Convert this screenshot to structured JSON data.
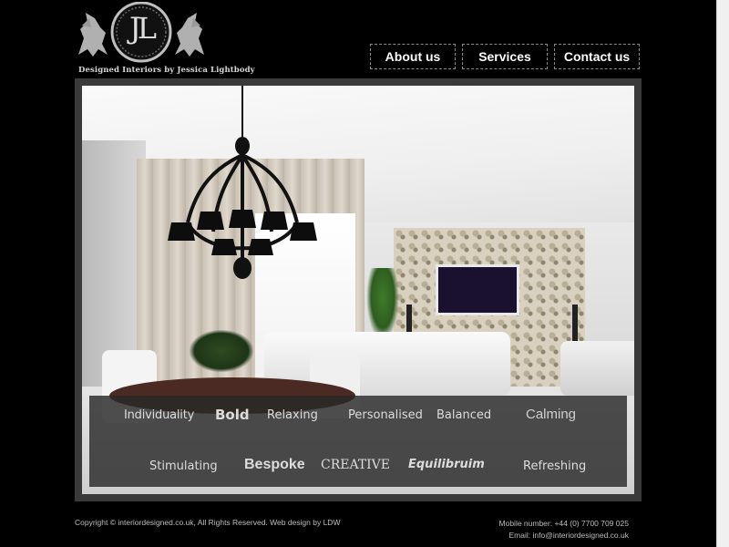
{
  "logo": {
    "monogram": "JL",
    "tagline": "Designed Interiors by Jessica Lightbody"
  },
  "nav": {
    "about_label": "About us",
    "services_label": "Services",
    "contact_label": "Contact us"
  },
  "hero": {
    "words": {
      "w1": "Individuality",
      "w2": "Bold",
      "w3": "Relaxing",
      "w4": "Personalised",
      "w5": "Balanced",
      "w6": "Calming",
      "w7": "Stimulating",
      "w8": "Bespoke",
      "w9": "CREATIVE",
      "w10": "Equilibruim",
      "w11": "Refreshing"
    }
  },
  "footer": {
    "copyright": "Copyright © interiordesigned.co.uk, All Rights Reserved. Web design by LDW",
    "mobile": "Mobile number: +44 (0) 7700 709 025",
    "email": "Email: info@interiordesigned.co.uk"
  },
  "colors": {
    "background": "#000000",
    "frame": "#3a3a3a",
    "nav_text": "#ffffff"
  }
}
